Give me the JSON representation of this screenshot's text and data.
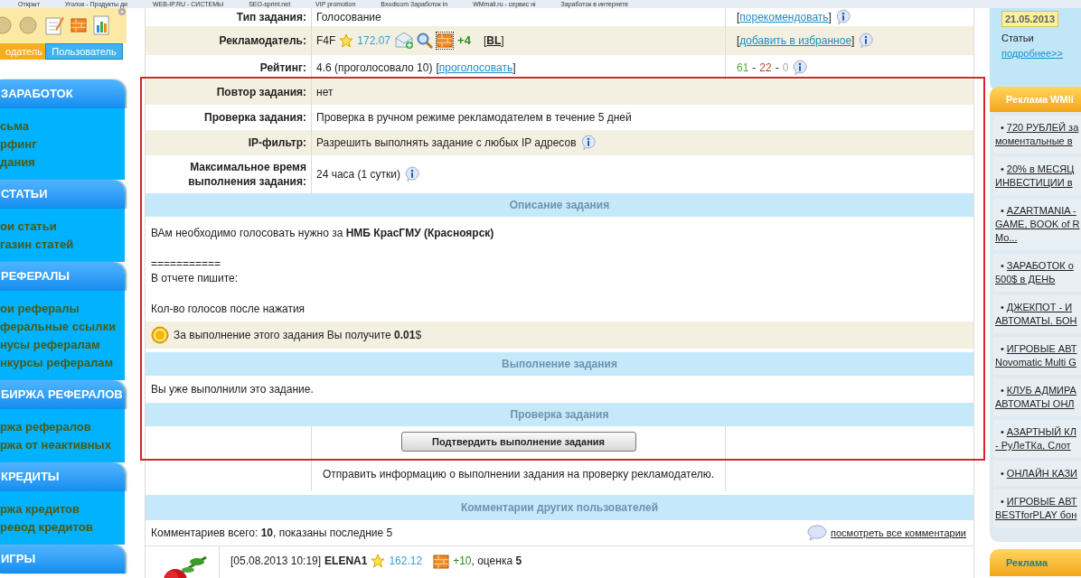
{
  "bookmarks": [
    "Открыт",
    "Уголок - Продукты ди",
    "WEB-IP.RU - СИСТЕМЫ",
    "SEO-sprint.net",
    "VIP promotion",
    "Bxodicom Заработок in",
    "WMmail.ru - сервис ні",
    "Заработок в интернете"
  ],
  "user_panel": {
    "tabs": [
      {
        "label": "одатель",
        "selected": true
      },
      {
        "label": "Пользователь",
        "selected": false
      }
    ]
  },
  "menu": [
    {
      "title": "ЗАРАБОТОК",
      "items": [
        "сьма",
        "рфинг",
        "дания"
      ]
    },
    {
      "title": "СТАТЬИ",
      "items": [
        "ои статьи",
        "газин статей"
      ]
    },
    {
      "title": "РЕФЕРАЛЫ",
      "items": [
        "ои рефералы",
        "феральные ссылки",
        "нусы рефералам",
        "нкурсы рефералам"
      ]
    },
    {
      "title": "БИРЖА РЕФЕРАЛОВ",
      "items": [
        "ржа рефералов",
        "ржа от неактивных"
      ]
    },
    {
      "title": "КРЕДИТЫ",
      "items": [
        "ржа кредитов",
        "ревод кредитов"
      ]
    },
    {
      "title": "ИГРЫ"
    }
  ],
  "info_rows": [
    {
      "kind": "text",
      "label": "Тип задания:",
      "value": "Голосование",
      "side": {
        "kind": "link",
        "before": "[",
        "text": "порекомендовать",
        "after": "]",
        "info": true
      }
    },
    {
      "kind": "advertiser",
      "label": "Рекламодатель:",
      "name": "F4F",
      "score": "172.07",
      "bonus": "+4",
      "bl": {
        "before": "[",
        "text": "BL",
        "after": "]"
      },
      "side": {
        "kind": "link",
        "before": "[",
        "text": "добавить в избранное",
        "after": "]",
        "info": true
      }
    },
    {
      "kind": "rating",
      "label": "Рейтинг:",
      "value": "4.6 (проголосовало 10)",
      "link": {
        "before": "[",
        "text": "проголосовать",
        "after": "]"
      },
      "side": {
        "kind": "votes",
        "up": "61",
        "mid": "22",
        "down": "0",
        "sep": "-",
        "info": true
      }
    }
  ],
  "task_section": {
    "highlighted": true,
    "rows": [
      {
        "label": "Повтор задания:",
        "value": "нет",
        "info": false
      },
      {
        "label": "Проверка задания:",
        "value": "Проверка в ручном режиме рекламодателем в течение 5 дней",
        "info": false
      },
      {
        "label": "IP-фильтр:",
        "value": "Разрешить выполнять задание с любых IP адресов",
        "info": true
      },
      {
        "label": "Максимальное время выполнения задания:",
        "value": "24 часа (1 сутки)",
        "info": true
      }
    ],
    "description_header": "Описание задания",
    "description": [
      [
        "ВАм необходимо голосовать нужно за **НМБ КрасГМУ (Красноярск)**"
      ],
      [
        "===========",
        "В отчете пишите:"
      ],
      [
        "Кол-во голосов после нажатия"
      ]
    ],
    "reward": "За выполнение этого задания Вы получите **0.01**$",
    "execution_header": "Выполнение задания",
    "execution_status": "Вы уже выполнили это задание.",
    "check_header": "Проверка задания",
    "confirm_button": "Подтвердить выполнение задания"
  },
  "confirm_note": "Отправить информацию о выполнении задания на проверку рекламодателю.",
  "comments": {
    "header": "Комментарии других пользователей",
    "summary": "Комментариев всего: **10**, показаны последние 5",
    "all_link": "посмотреть все комментарии",
    "items": [
      {
        "kind": "picture",
        "date": "[05.08.2013 10:19]",
        "author": "ELENA1",
        "score": "162.12",
        "bonus": "+10",
        "grade": ", оценка **5**"
      }
    ]
  },
  "news": {
    "date": "21.05.2013",
    "title": "Статьи",
    "link": "подробнее>>"
  },
  "ads": {
    "title": "Реклама WMli",
    "items": [
      {
        "bullet": "•",
        "lines": [
          "720 РУБЛЕЙ за",
          "моментальные в"
        ]
      },
      {
        "bullet": "•",
        "lines": [
          "20% в МЕСЯЦ",
          "ИНВЕСТИЦИИ в"
        ]
      },
      {
        "bullet": "•",
        "lines": [
          "AZARTMANIA -",
          "GAME, BOOK of R",
          "Mo..."
        ]
      },
      {
        "bullet": "•",
        "lines": [
          "ЗАРАБОТОК о",
          "500$ в ДЕНЬ"
        ]
      },
      {
        "bullet": "•",
        "lines": [
          "ДЖЕКПОТ - И",
          "АВТОМАТЫ. БОН"
        ]
      },
      {
        "bullet": "•",
        "lines": [
          "ИГРОВЫЕ АВТ",
          "Novomatic Multi G"
        ]
      },
      {
        "bullet": "•",
        "lines": [
          "КЛУБ АДМИРА",
          "АВТОМАТЫ ОНЛ"
        ]
      },
      {
        "bullet": "•",
        "lines": [
          "АЗАРТНЫЙ КЛ",
          "- РуЛеТКа, Слот"
        ]
      },
      {
        "bullet": "•",
        "lines": [
          "ОНЛАЙН КАЗИ"
        ]
      },
      {
        "bullet": "•",
        "lines": [
          "ИГРОВЫЕ АВТ",
          "BESTforPLAY бон"
        ]
      }
    ]
  },
  "ads2": {
    "title": "Реклама"
  }
}
